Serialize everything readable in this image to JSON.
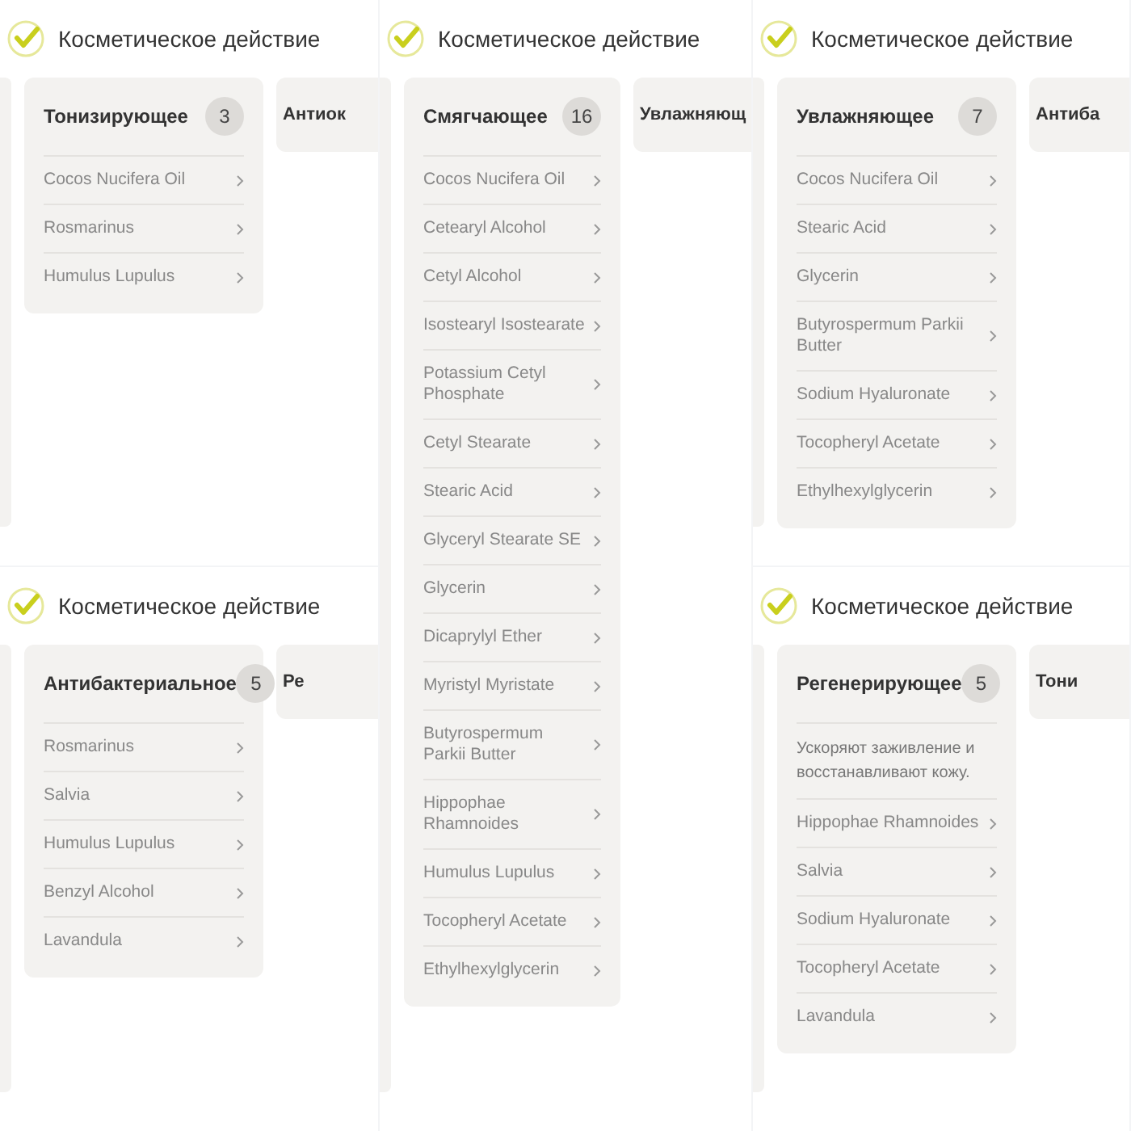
{
  "columns": [
    [
      {
        "heading": "Косметическое действие",
        "card": {
          "title": "Тонизирующее",
          "count": "3",
          "items": [
            "Cocos Nucifera Oil",
            "Rosmarinus",
            "Humulus Lupulus"
          ]
        },
        "next_card_title": "Антиок"
      },
      {
        "heading": "Косметическое действие",
        "card": {
          "title": "Антибактериальное",
          "count": "5",
          "items": [
            "Rosmarinus",
            "Salvia",
            "Humulus Lupulus",
            "Benzyl Alcohol",
            "Lavandula"
          ]
        },
        "next_card_title": "Ре"
      }
    ],
    [
      {
        "heading": "Косметическое действие",
        "card": {
          "title": "Смягчающее",
          "count": "16",
          "items": [
            "Cocos Nucifera Oil",
            "Cetearyl Alcohol",
            "Cetyl Alcohol",
            "Isostearyl Isostearate",
            "Potassium Cetyl Phosphate",
            "Cetyl Stearate",
            "Stearic Acid",
            "Glyceryl Stearate SE",
            "Glycerin",
            "Dicaprylyl Ether",
            "Myristyl Myristate",
            "Butyrospermum Parkii Butter",
            "Hippophae Rhamnoides",
            "Humulus Lupulus",
            "Tocopheryl Acetate",
            "Ethylhexylglycerin"
          ]
        },
        "next_card_title": "Увлажняющ"
      }
    ],
    [
      {
        "heading": "Косметическое действие",
        "card": {
          "title": "Увлажняющее",
          "count": "7",
          "items": [
            "Cocos Nucifera Oil",
            "Stearic Acid",
            "Glycerin",
            "Butyrospermum Parkii Butter",
            "Sodium Hyaluronate",
            "Tocopheryl Acetate",
            "Ethylhexylglycerin"
          ]
        },
        "next_card_title": "Антиба"
      },
      {
        "heading": "Косметическое действие",
        "card": {
          "title": "Регенерирующее",
          "count": "5",
          "description": "Ускоряют заживление и восстанавливают кожу.",
          "items": [
            "Hippophae Rhamnoides",
            "Salvia",
            "Sodium Hyaluronate",
            "Tocopheryl Acetate",
            "Lavandula"
          ]
        },
        "next_card_title": "Тони"
      }
    ]
  ]
}
